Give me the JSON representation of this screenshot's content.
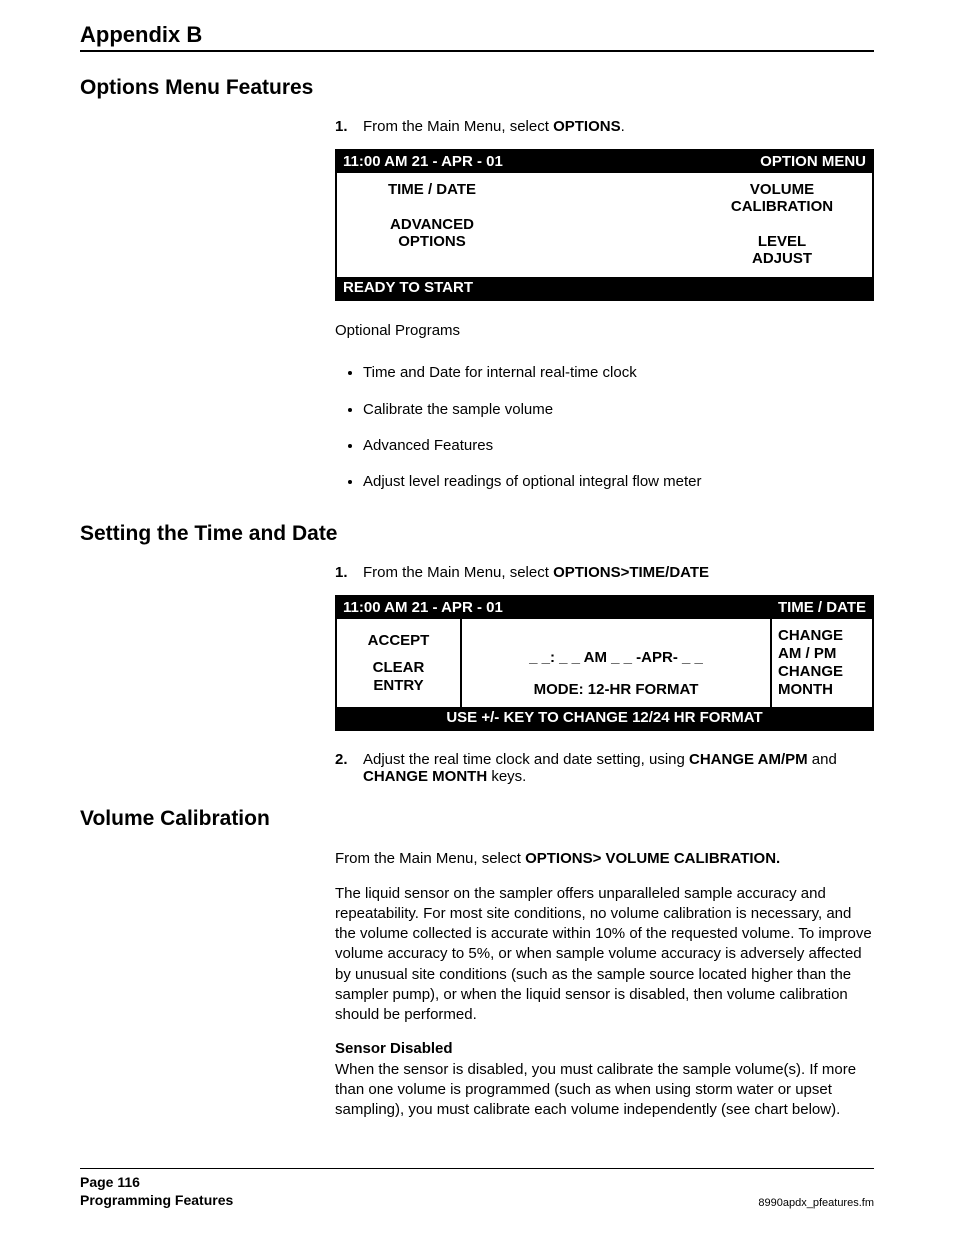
{
  "header": {
    "appendix": "Appendix B"
  },
  "sections": {
    "options_menu": {
      "title": "Options Menu Features",
      "step1_num": "1.",
      "step1_pre": "From the Main Menu, select ",
      "step1_bold": "OPTIONS",
      "step1_post": ".",
      "screen": {
        "time": "11:00 AM 21 - APR - 01",
        "title": "OPTION MENU",
        "left1": "TIME / DATE",
        "left2a": "ADVANCED",
        "left2b": "OPTIONS",
        "right1a": "VOLUME",
        "right1b": "CALIBRATION",
        "right2a": "LEVEL",
        "right2b": "ADJUST",
        "footer": "READY TO START"
      },
      "optional_label": "Optional Programs",
      "bullets": [
        "Time and Date for internal real-time clock",
        "Calibrate the sample volume",
        "Advanced Features",
        "Adjust level readings of optional integral flow meter"
      ]
    },
    "time_date": {
      "title": "Setting the Time and Date",
      "step1_num": "1.",
      "step1_pre": "From the Main Menu, select ",
      "step1_bold": "OPTIONS>TIME/DATE",
      "screen": {
        "time": "11:00 AM 21 - APR - 01",
        "title": "TIME / DATE",
        "left1": "ACCEPT",
        "left2a": "CLEAR",
        "left2b": "ENTRY",
        "mid1": "_ _: _ _ AM _ _ -APR- _ _",
        "mid2": "MODE: 12-HR FORMAT",
        "right1a": "CHANGE",
        "right1b": "AM / PM",
        "right2a": "CHANGE",
        "right2b": "MONTH",
        "footer": "USE +/- KEY TO CHANGE 12/24 HR FORMAT"
      },
      "step2_num": "2.",
      "step2_a": "Adjust the real time clock and date setting, using ",
      "step2_b1": "CHANGE AM/PM",
      "step2_c": " and ",
      "step2_b2": "CHANGE MONTH",
      "step2_d": " keys."
    },
    "vol_cal": {
      "title": "Volume Calibration",
      "intro_a": "From the Main Menu, select ",
      "intro_b": "OPTIONS> VOLUME CALIBRATION.",
      "para1": "The liquid sensor on the sampler offers unparalleled sample accuracy and repeatability. For most site conditions, no volume calibration is necessary, and the volume collected is accurate within 10% of the requested volume. To improve volume accuracy to 5%, or when sample volume accuracy is adversely affected by unusual site conditions (such as the sample source located higher than the sampler pump), or when the liquid sensor is disabled, then volume calibration should be performed.",
      "sub_head": "Sensor Disabled",
      "sub_body": "When the sensor is disabled, you must calibrate the sample volume(s). If more than one volume is programmed (such as when using storm water or upset sampling), you must calibrate each volume independently (see chart below)."
    }
  },
  "footer": {
    "page": "Page 116",
    "section": "Programming Features",
    "file": "8990apdx_pfeatures.fm"
  }
}
